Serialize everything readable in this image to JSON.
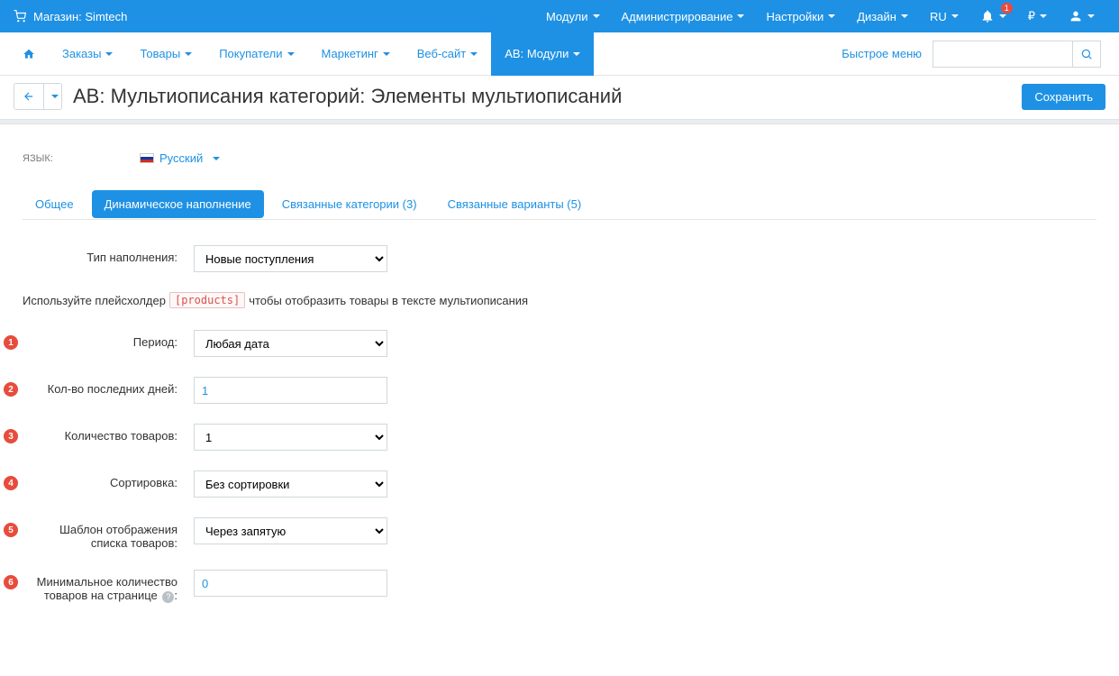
{
  "topbar": {
    "store_prefix": "Магазин:",
    "store_name": "Simtech",
    "menu": {
      "modules": "Модули",
      "admin": "Администрирование",
      "settings": "Настройки",
      "design": "Дизайн",
      "lang": "RU",
      "currency": "₽"
    },
    "notif_count": "1"
  },
  "mainnav": {
    "orders": "Заказы",
    "products": "Товары",
    "customers": "Покупатели",
    "marketing": "Маркетинг",
    "website": "Веб-сайт",
    "ab_modules": "AB: Модули",
    "quick_menu": "Быстрое меню"
  },
  "page": {
    "title": "AB: Мультиописания категорий: Элементы мультиописаний",
    "save_btn": "Сохранить"
  },
  "lang_selector": {
    "label": "ЯЗЫК:",
    "value": "Русский"
  },
  "tabs": {
    "general": "Общее",
    "dynamic": "Динамическое наполнение",
    "categories": "Связанные категории (3)",
    "variants": "Связанные варианты (5)"
  },
  "form": {
    "fill_type": {
      "label": "Тип наполнения:",
      "value": "Новые поступления"
    },
    "hint_pre": "Используйте плейсхолдер",
    "hint_code": "[products]",
    "hint_post": "чтобы отобразить товары в тексте мультиописания",
    "period": {
      "label": "Период:",
      "value": "Любая дата",
      "badge": "1"
    },
    "last_days": {
      "label": "Кол-во последних дней:",
      "value": "1",
      "badge": "2"
    },
    "qty": {
      "label": "Количество товаров:",
      "value": "1",
      "badge": "3"
    },
    "sort": {
      "label": "Сортировка:",
      "value": "Без сортировки",
      "badge": "4"
    },
    "template": {
      "label": "Шаблон отображения списка товаров:",
      "value": "Через запятую",
      "badge": "5"
    },
    "min_qty": {
      "label_1": "Минимальное количество",
      "label_2": "товаров на странице",
      "value": "0",
      "badge": "6"
    }
  }
}
